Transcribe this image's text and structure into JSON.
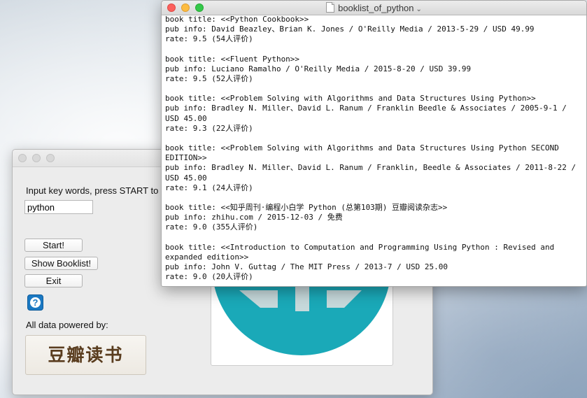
{
  "app_window": {
    "prompt_label": "Input key words, press START to",
    "keyword_value": "python",
    "start_label": "Start!",
    "show_booklist_label": "Show Booklist!",
    "exit_label": "Exit",
    "help_label": "?",
    "powered_by_label": "All data powered by:",
    "douban_logo_text": "豆瓣读书"
  },
  "text_window": {
    "title": "booklist_of_python",
    "records": [
      {
        "title_line": "book title: <<Python Cookbook>>",
        "pub_line": "pub info: David Beazley、Brian K. Jones / O'Reilly Media / 2013-5-29 / USD 49.99",
        "rate_line": "rate: 9.5 (54人评价)"
      },
      {
        "title_line": "book title: <<Fluent Python>>",
        "pub_line": "pub info: Luciano Ramalho / O'Reilly Media / 2015-8-20 / USD 39.99",
        "rate_line": "rate: 9.5 (52人评价)"
      },
      {
        "title_line": "book title: <<Problem Solving with Algorithms and Data Structures Using Python>>",
        "pub_line": "pub info: Bradley N. Miller、David L. Ranum / Franklin Beedle & Associates / 2005-9-1 / USD 45.00",
        "rate_line": "rate: 9.3 (22人评价)"
      },
      {
        "title_line": "book title: <<Problem Solving with Algorithms and Data Structures Using Python SECOND EDITION>>",
        "pub_line": "pub info: Bradley N. Miller、David L. Ranum / Franklin, Beedle & Associates / 2011-8-22 / USD 45.00",
        "rate_line": "rate: 9.1 (24人评价)"
      },
      {
        "title_line": "book title: <<知乎周刊·编程小白学 Python (总第103期) 豆瓣阅读杂志>>",
        "pub_line": "pub info: zhihu.com / 2015-12-03 / 免费",
        "rate_line": "rate: 9.0 (355人评价)"
      },
      {
        "title_line": "book title: <<Introduction to Computation and Programming Using Python : Revised and expanded edition>>",
        "pub_line": "pub info: John V. Guttag / The MIT Press / 2013-7 / USD 25.00",
        "rate_line": "rate: 9.0 (20人评价)"
      }
    ]
  },
  "colors": {
    "close": "#fc605c",
    "minimize": "#fdbc40",
    "maximize": "#34c84a",
    "help_blue": "#1a78c2",
    "teal_image": "#1aa9b8"
  }
}
